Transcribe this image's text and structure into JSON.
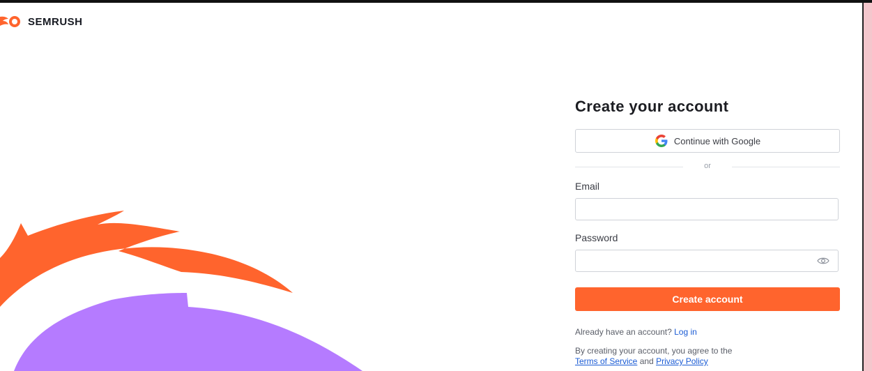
{
  "brand": {
    "name": "SEMRUSH",
    "color": "#ff642d",
    "icon": "semrush-fireball-icon"
  },
  "decor": {
    "flame_color": "#ff642d",
    "blob_color": "#b57bff"
  },
  "form": {
    "title": "Create your account",
    "google_button_label": "Continue with Google",
    "divider_label": "or",
    "email_label": "Email",
    "email_value": "",
    "password_label": "Password",
    "password_value": "",
    "password_toggle_icon": "eye-icon",
    "submit_label": "Create account",
    "submit_color": "#ff642d",
    "login_prompt": "Already have an account?",
    "login_link": "Log in",
    "terms_prefix": "By creating your account, you agree to the",
    "terms_link": "Terms of Service",
    "terms_and": "and",
    "privacy_link": "Privacy Policy"
  }
}
